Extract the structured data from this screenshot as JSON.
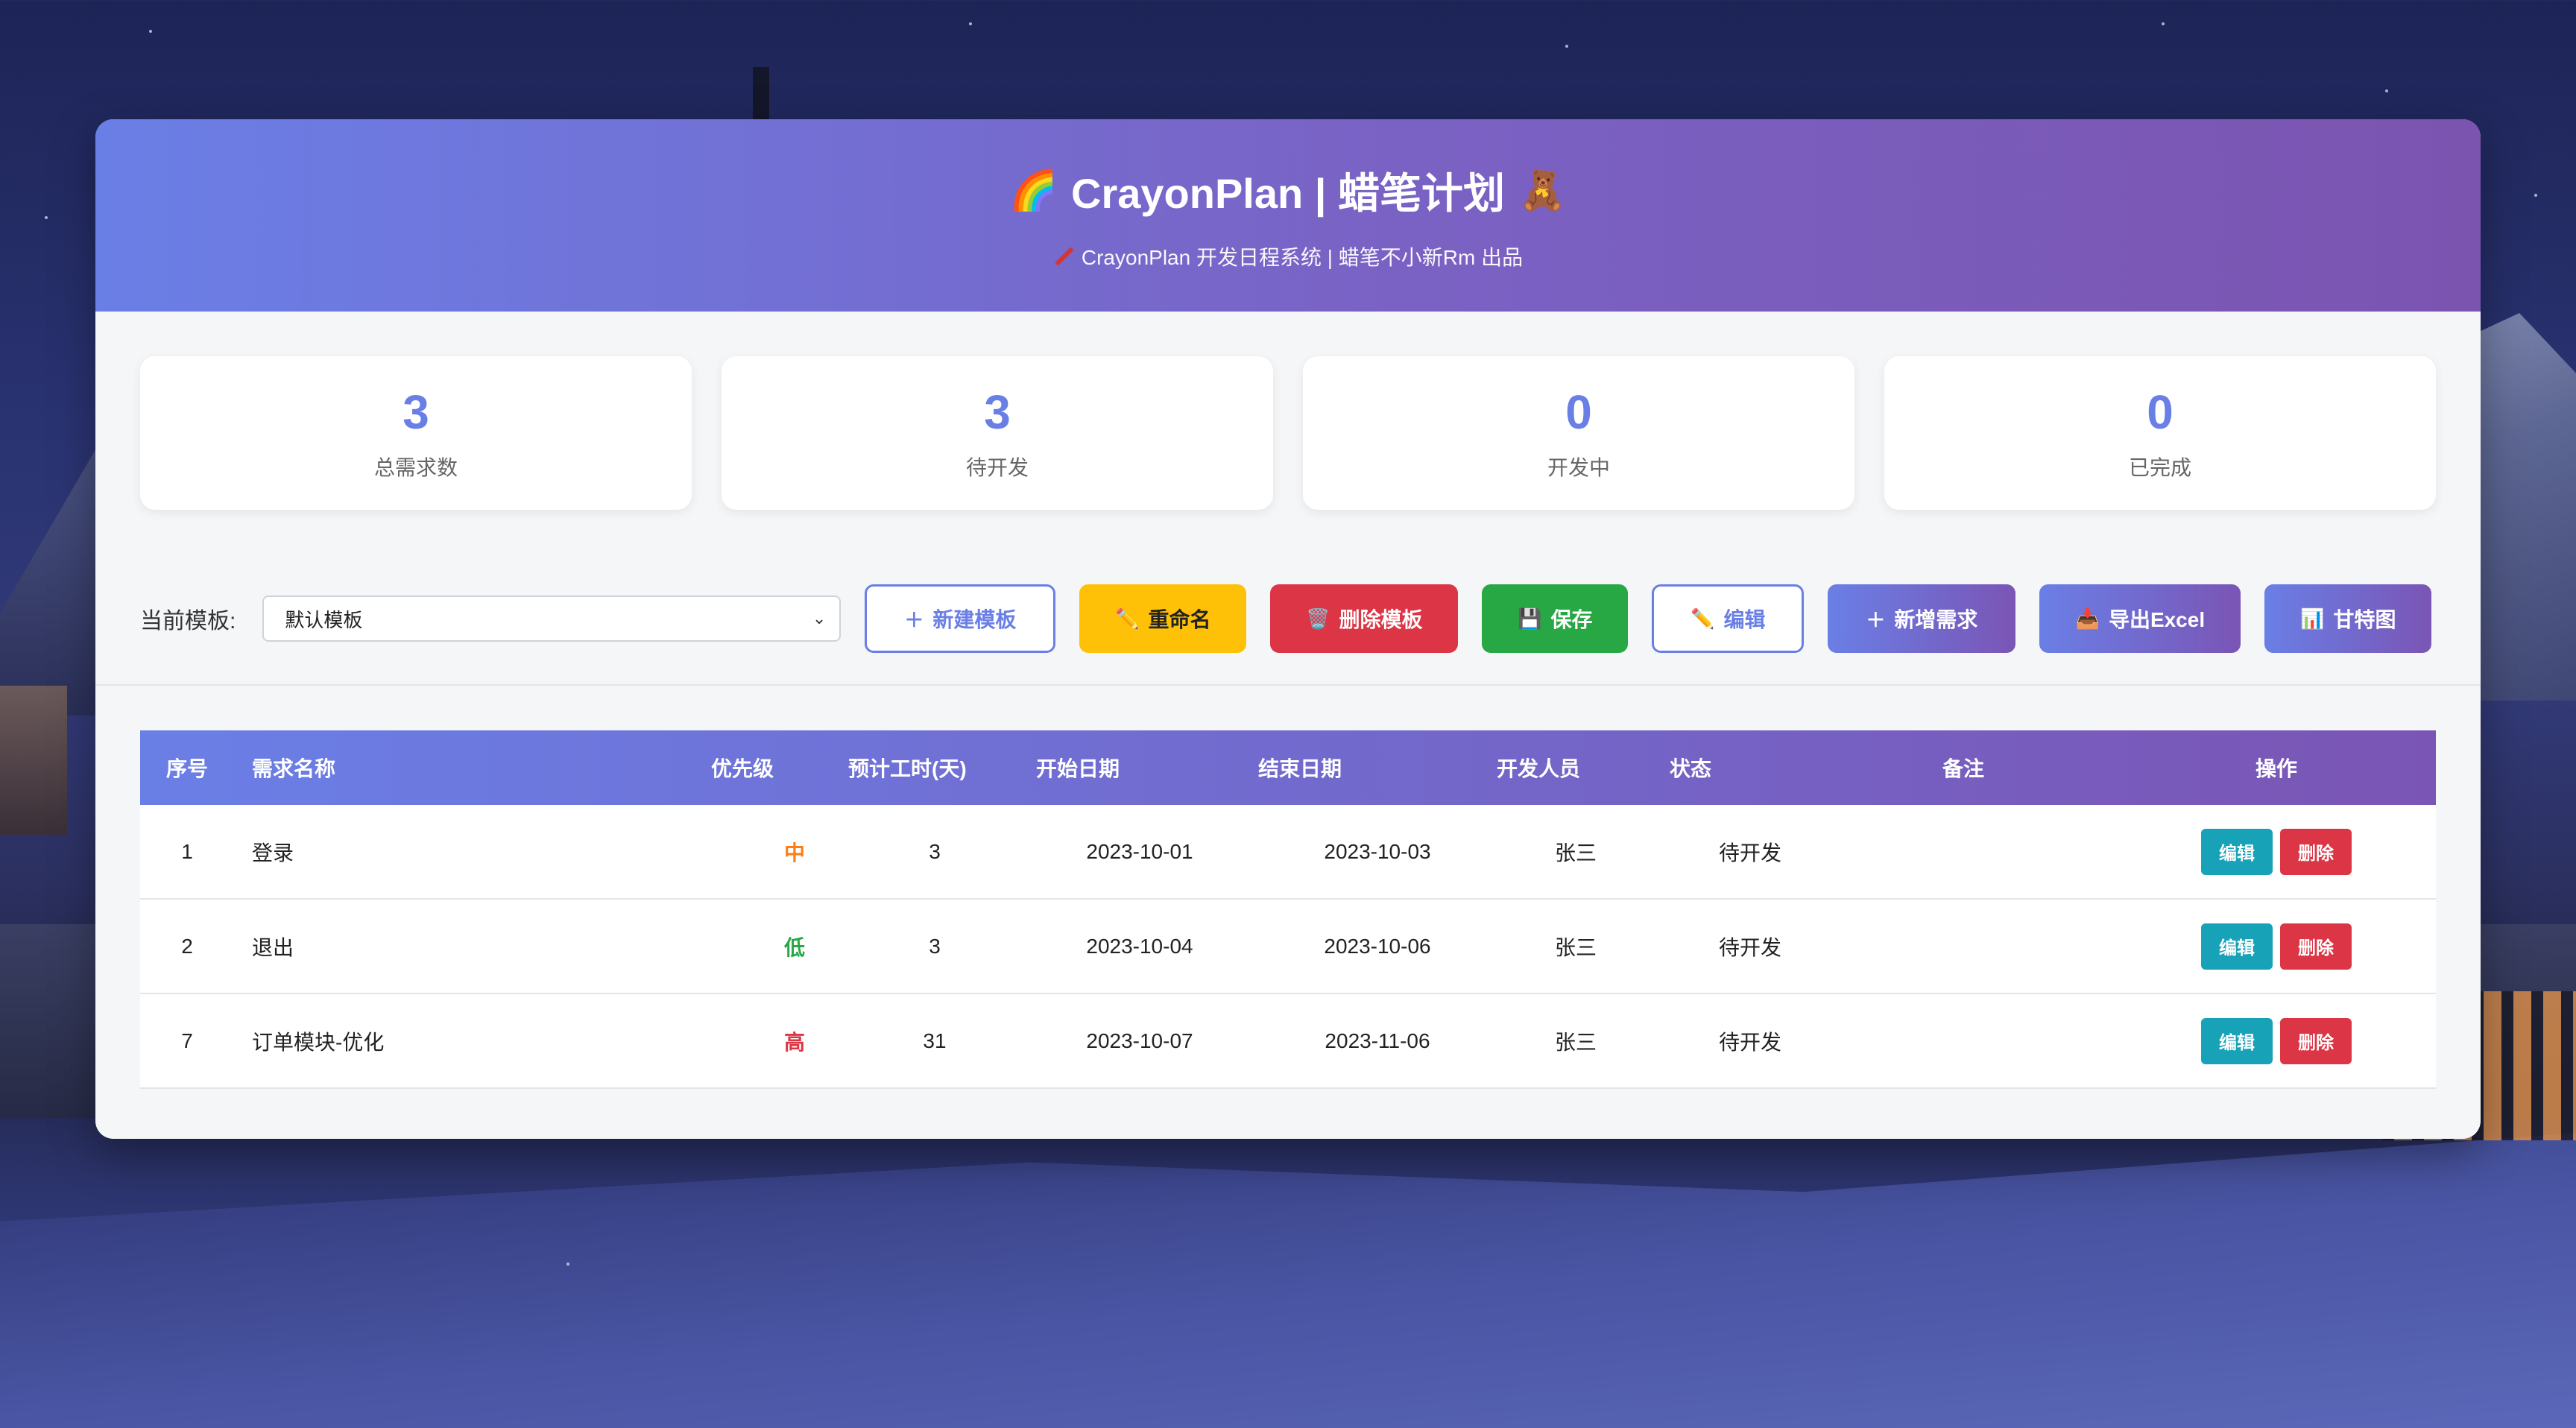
{
  "header": {
    "title_icon_left": "🌈",
    "title": "CrayonPlan | 蜡笔计划",
    "title_icon_right": "🧸",
    "subtitle_icon": "crayon-icon",
    "subtitle": "CrayonPlan 开发日程系统 | 蜡笔不小新Rm 出品"
  },
  "stats": [
    {
      "value": "3",
      "label": "总需求数"
    },
    {
      "value": "3",
      "label": "待开发"
    },
    {
      "value": "0",
      "label": "开发中"
    },
    {
      "value": "0",
      "label": "已完成"
    }
  ],
  "toolbar": {
    "template_label": "当前模板:",
    "template_selected": "默认模板",
    "buttons": {
      "new_template": {
        "icon": "＋",
        "label": "新建模板"
      },
      "rename": {
        "icon": "✏️",
        "label": "重命名"
      },
      "delete_template": {
        "icon": "🗑️",
        "label": "删除模板"
      },
      "save": {
        "icon": "💾",
        "label": "保存"
      },
      "edit": {
        "icon": "✏️",
        "label": "编辑"
      },
      "add_requirement": {
        "icon": "＋",
        "label": "新增需求"
      },
      "export_excel": {
        "icon": "📥",
        "label": "导出Excel"
      },
      "gantt": {
        "icon": "📊",
        "label": "甘特图"
      }
    }
  },
  "table": {
    "headers": [
      "序号",
      "需求名称",
      "优先级",
      "预计工时(天)",
      "开始日期",
      "结束日期",
      "开发人员",
      "状态",
      "备注",
      "操作"
    ],
    "rows": [
      {
        "id": "1",
        "name": "登录",
        "priority": "中",
        "priority_color": "#fd7e14",
        "days": "3",
        "start": "2023-10-01",
        "end": "2023-10-03",
        "dev": "张三",
        "status": "待开发",
        "note": ""
      },
      {
        "id": "2",
        "name": "退出",
        "priority": "低",
        "priority_color": "#28a745",
        "days": "3",
        "start": "2023-10-04",
        "end": "2023-10-06",
        "dev": "张三",
        "status": "待开发",
        "note": ""
      },
      {
        "id": "7",
        "name": "订单模块-优化",
        "priority": "高",
        "priority_color": "#dc3545",
        "days": "31",
        "start": "2023-10-07",
        "end": "2023-11-06",
        "dev": "张三",
        "status": "待开发",
        "note": ""
      }
    ],
    "row_actions": {
      "edit": "编辑",
      "delete": "删除"
    }
  },
  "colors": {
    "accent": "#6a7fe6",
    "accent_end": "#7a55b5",
    "warning": "#ffc107",
    "danger": "#dc3545",
    "success": "#28a745",
    "info": "#17a2b8"
  }
}
